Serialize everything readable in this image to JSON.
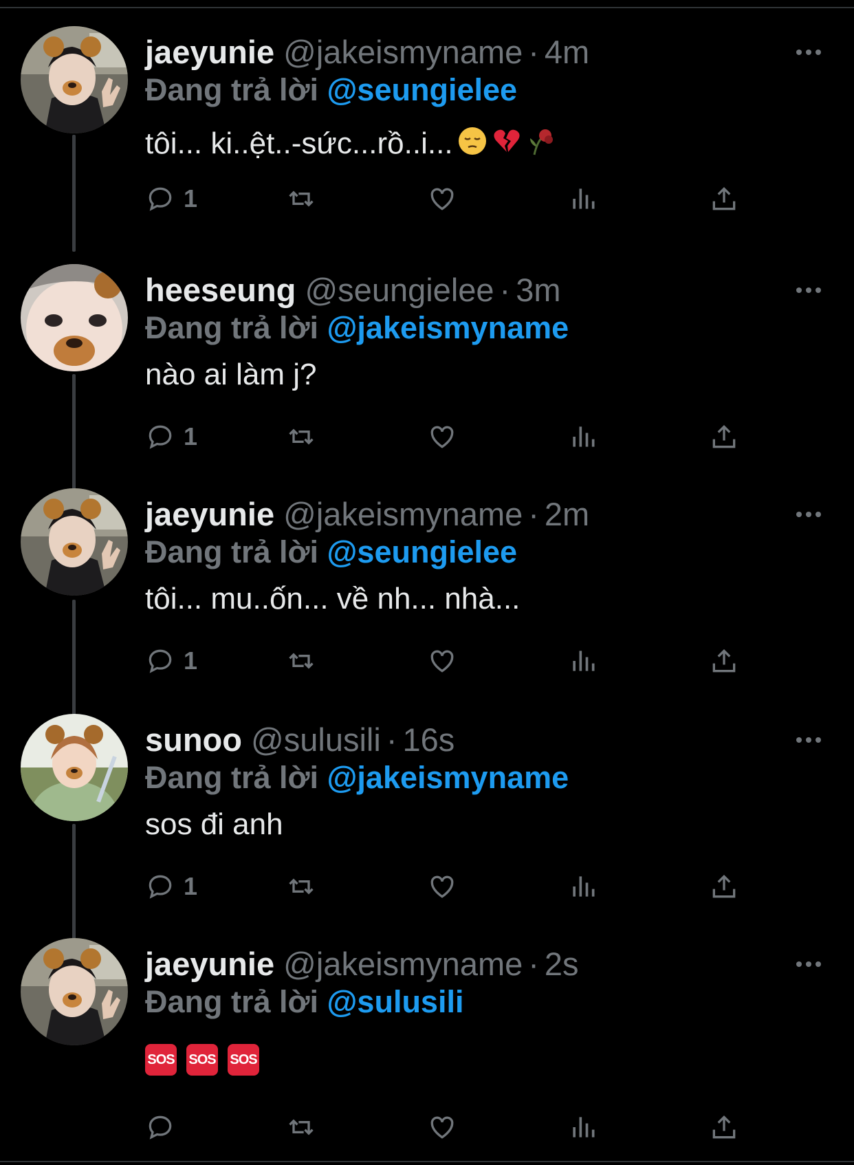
{
  "tweets": [
    {
      "display_name": "jaeyunie",
      "handle": "@jakeismyname",
      "time": "4m",
      "reply_prefix": "Đang trả lời",
      "reply_to": "@seungielee",
      "text": "tôi... ki..ệt..-sức...rồ..i...",
      "emojis": [
        "pensive-face-emoji",
        "broken-heart-emoji",
        "wilted-flower-emoji"
      ],
      "reply_count": "1",
      "avatar": "avatar-bear-filter-hand"
    },
    {
      "display_name": "heeseung",
      "handle": "@seungielee",
      "time": "3m",
      "reply_prefix": "Đang trả lời",
      "reply_to": "@jakeismyname",
      "text": "nào ai làm j?",
      "reply_count": "1",
      "avatar": "avatar-bear-filter-closeup"
    },
    {
      "display_name": "jaeyunie",
      "handle": "@jakeismyname",
      "time": "2m",
      "reply_prefix": "Đang trả lời",
      "reply_to": "@seungielee",
      "text": "tôi... mu..ốn... về nh... nhà...",
      "reply_count": "1",
      "avatar": "avatar-bear-filter-hand"
    },
    {
      "display_name": "sunoo",
      "handle": "@sulusili",
      "time": "16s",
      "reply_prefix": "Đang trả lời",
      "reply_to": "@jakeismyname",
      "text": "sos đi anh",
      "reply_count": "1",
      "avatar": "avatar-bear-filter-outdoor"
    },
    {
      "display_name": "jaeyunie",
      "handle": "@jakeismyname",
      "time": "2s",
      "reply_prefix": "Đang trả lời",
      "reply_to": "@sulusili",
      "sos_labels": [
        "SOS",
        "SOS",
        "SOS"
      ],
      "reply_count": "",
      "avatar": "avatar-bear-filter-hand"
    }
  ],
  "separator": "·",
  "colors": {
    "background": "#000000",
    "text": "#e7e9ea",
    "muted": "#71767b",
    "link": "#1d9bf0",
    "thread_line": "#3a3d41",
    "sos": "#e0243a"
  },
  "icons": [
    "reply-icon",
    "retweet-icon",
    "like-icon",
    "views-icon",
    "share-icon",
    "more-icon"
  ]
}
